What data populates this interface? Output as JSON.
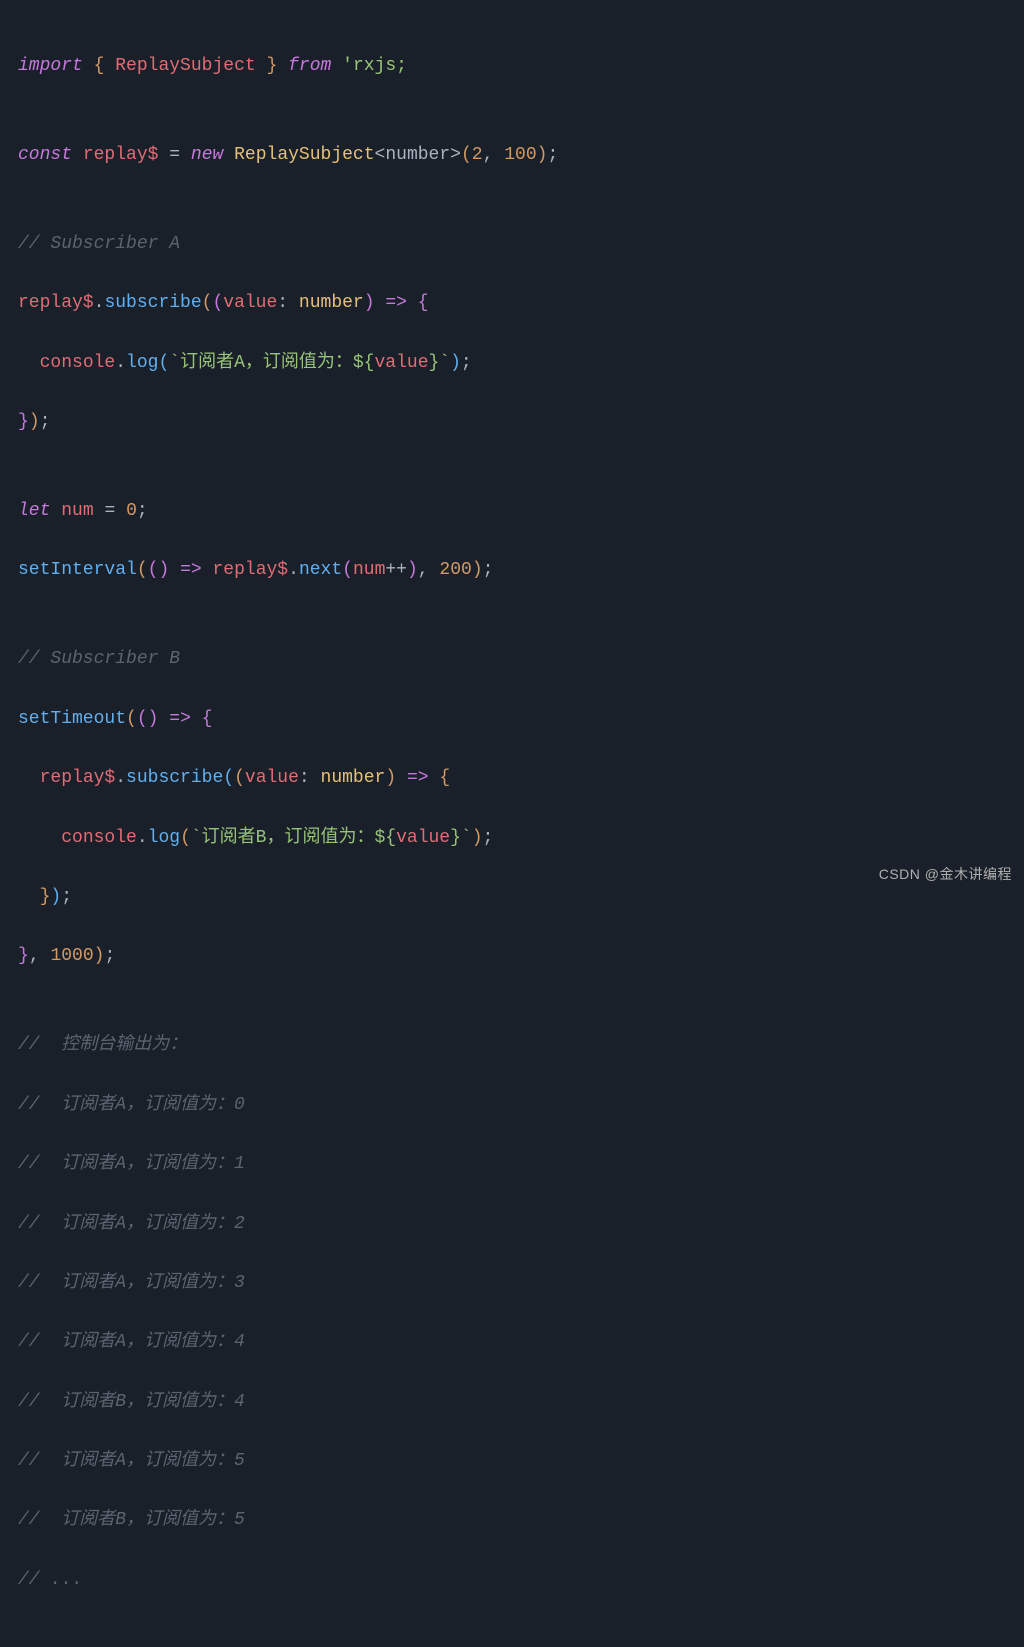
{
  "code": {
    "l1_import": "import",
    "l1_brace_open": "{",
    "l1_replaysubject": "ReplaySubject",
    "l1_brace_close": "}",
    "l1_from": "from",
    "l1_rxjs": "'rxjs;",
    "l2_const": "const",
    "l2_replay": "replay$",
    "l2_eq": "=",
    "l2_new": "new",
    "l2_rs": "ReplaySubject",
    "l2_generic": "<number>",
    "l2_po": "(",
    "l2_n1": "2",
    "l2_comma": ",",
    "l2_n2": "100",
    "l2_pc": ")",
    "l2_semi": ";",
    "l3_comment": "// Subscriber A",
    "l4_replay": "replay$",
    "l4_dot": ".",
    "l4_sub": "subscribe",
    "l4_po": "(",
    "l4_po2": "(",
    "l4_value": "value",
    "l4_colon": ":",
    "l4_number": "number",
    "l4_pc2": ")",
    "l4_arrow": "=>",
    "l4_bo": "{",
    "l5_console": "console",
    "l5_dot": ".",
    "l5_log": "log",
    "l5_po": "(",
    "l5_str": "`订阅者A，订阅值为：${",
    "l5_value": "value",
    "l5_str2": "}`",
    "l5_pc": ")",
    "l5_semi": ";",
    "l6_bc": "}",
    "l6_pc": ")",
    "l6_semi": ";",
    "l7_let": "let",
    "l7_num": "num",
    "l7_eq": "=",
    "l7_zero": "0",
    "l7_semi": ";",
    "l8_si": "setInterval",
    "l8_po": "(",
    "l8_po2": "(",
    "l8_pc2": ")",
    "l8_arrow": "=>",
    "l8_replay": "replay$",
    "l8_dot": ".",
    "l8_next": "next",
    "l8_po3": "(",
    "l8_num": "num",
    "l8_inc": "++",
    "l8_pc3": ")",
    "l8_comma": ",",
    "l8_n": "200",
    "l8_pc": ")",
    "l8_semi": ";",
    "l9_comment": "// Subscriber B",
    "l10_st": "setTimeout",
    "l10_po": "(",
    "l10_po2": "(",
    "l10_pc2": ")",
    "l10_arrow": "=>",
    "l10_bo": "{",
    "l11_replay": "replay$",
    "l11_dot": ".",
    "l11_sub": "subscribe",
    "l11_po": "(",
    "l11_po2": "(",
    "l11_value": "value",
    "l11_colon": ":",
    "l11_number": "number",
    "l11_pc2": ")",
    "l11_arrow": "=>",
    "l11_bo": "{",
    "l12_console": "console",
    "l12_dot": ".",
    "l12_log": "log",
    "l12_po": "(",
    "l12_str": "`订阅者B，订阅值为：${",
    "l12_value": "value",
    "l12_str2": "}`",
    "l12_pc": ")",
    "l12_semi": ";",
    "l13_bc": "}",
    "l13_pc": ")",
    "l13_semi": ";",
    "l14_bc": "}",
    "l14_comma": ",",
    "l14_n": "1000",
    "l14_pc": ")",
    "l14_semi": ";",
    "c1": "//  控制台输出为：",
    "c2": "//  订阅者A，订阅值为：0",
    "c3": "//  订阅者A，订阅值为：1",
    "c4": "//  订阅者A，订阅值为：2",
    "c5": "//  订阅者A，订阅值为：3",
    "c6": "//  订阅者A，订阅值为：4",
    "c7": "//  订阅者B，订阅值为：4",
    "c8": "//  订阅者A，订阅值为：5",
    "c9": "//  订阅者B，订阅值为：5",
    "c10": "// ..."
  },
  "watermark": "CSDN @金木讲编程"
}
